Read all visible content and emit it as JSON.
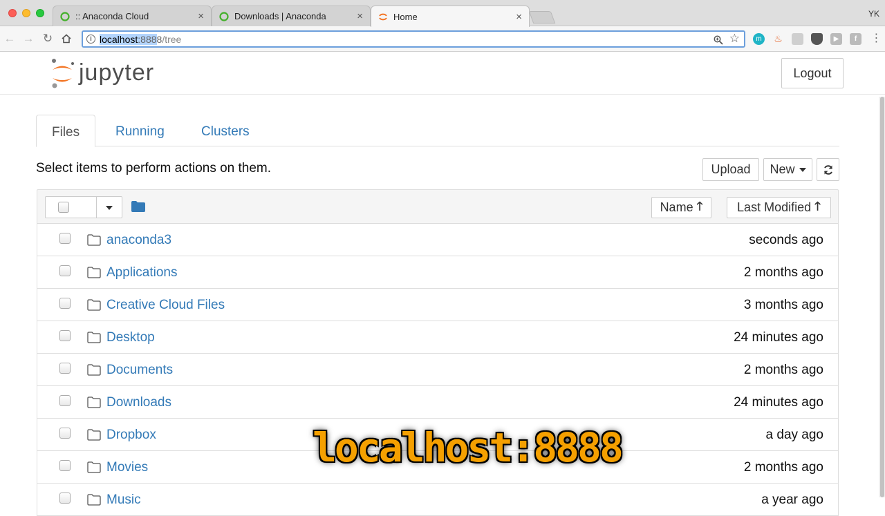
{
  "browser": {
    "tabs": [
      {
        "label": ":: Anaconda Cloud"
      },
      {
        "label": "Downloads | Anaconda"
      },
      {
        "label": "Home"
      }
    ],
    "profile": "YK",
    "url": {
      "host": "localhost",
      "port_selected": ":888",
      "port_rest": "8",
      "path": "/tree"
    }
  },
  "jupyter": {
    "logo_text": "jupyter",
    "logout": "Logout",
    "tabs": [
      "Files",
      "Running",
      "Clusters"
    ],
    "hint": "Select items to perform actions on them.",
    "upload": "Upload",
    "new": "New",
    "sort_name": "Name",
    "sort_modified": "Last Modified",
    "files": [
      {
        "name": "anaconda3",
        "modified": "seconds ago"
      },
      {
        "name": "Applications",
        "modified": "2 months ago"
      },
      {
        "name": "Creative Cloud Files",
        "modified": "3 months ago"
      },
      {
        "name": "Desktop",
        "modified": "24 minutes ago"
      },
      {
        "name": "Documents",
        "modified": "2 months ago"
      },
      {
        "name": "Downloads",
        "modified": "24 minutes ago"
      },
      {
        "name": "Dropbox",
        "modified": "a day ago"
      },
      {
        "name": "Movies",
        "modified": "2 months ago"
      },
      {
        "name": "Music",
        "modified": "a year ago"
      }
    ]
  },
  "overlay_caption": "localhost:8888",
  "colors": {
    "link": "#337ab7",
    "accent": "#f37626",
    "overlay": "#f5a000"
  }
}
